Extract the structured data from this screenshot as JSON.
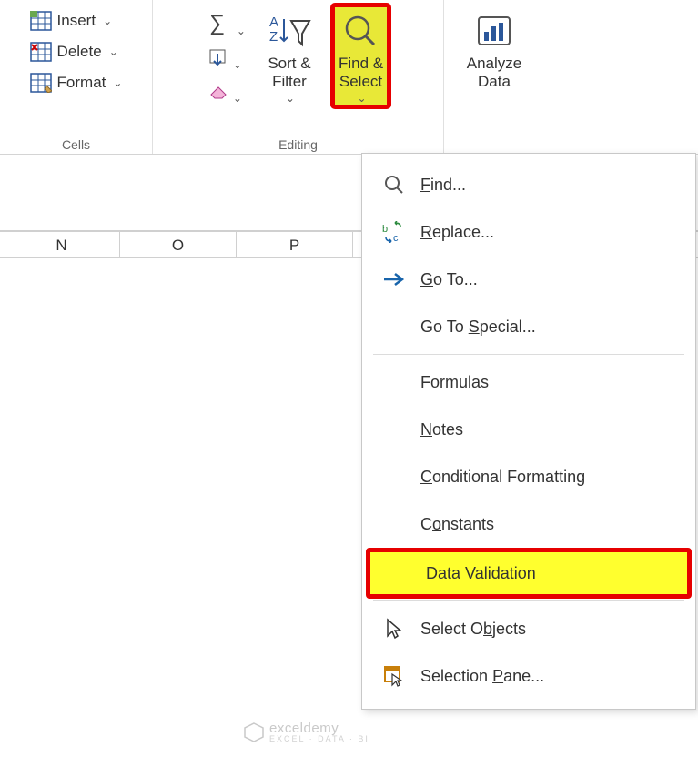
{
  "ribbon": {
    "cells": {
      "insert": "Insert",
      "delete": "Delete",
      "format": "Format",
      "group_label": "Cells"
    },
    "editing": {
      "sort_filter": "Sort &\nFilter",
      "find_select": "Find &\nSelect",
      "group_label": "Editing"
    },
    "analyze": {
      "label": "Analyze\nData"
    }
  },
  "columns": [
    "N",
    "O",
    "P"
  ],
  "menu": {
    "find": "Find...",
    "replace": "Replace...",
    "goto": "Go To...",
    "goto_special": "Go To Special...",
    "formulas": "Formulas",
    "notes": "Notes",
    "cond_fmt": "Conditional Formatting",
    "constants": "Constants",
    "data_validation": "Data Validation",
    "select_objects": "Select Objects",
    "selection_pane": "Selection Pane..."
  },
  "watermark": {
    "brand": "exceldemy",
    "tag": "EXCEL · DATA · BI"
  }
}
